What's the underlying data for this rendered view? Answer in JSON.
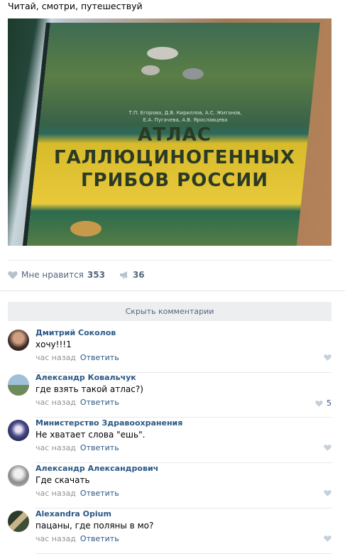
{
  "post": {
    "text": "Читай, смотри, путешествуй",
    "book_authors_line1": "Т.П. Егорова, Д.В. Кириллов, А.С. Жиганов,",
    "book_authors_line2": "Е.А. Пугачева, А.В. Ярославцева",
    "book_title_1": "АТЛАС",
    "book_title_2": "ГАЛЛЮЦИНОГЕННЫХ",
    "book_title_3": "ГРИБОВ РОССИИ",
    "like_label": "Мне нравится",
    "like_count": "353",
    "share_count": "36",
    "hide_comments_label": "Скрыть комментарии"
  },
  "comments": [
    {
      "author": "Дмитрий Соколов",
      "text": "хочу!!!1",
      "time": "час назад",
      "reply": "Ответить",
      "likes": ""
    },
    {
      "author": "Александр Ковальчук",
      "text": "где взять такой атлас?)",
      "time": "час назад",
      "reply": "Ответить",
      "likes": "5"
    },
    {
      "author": "Министерство Здравоохранения",
      "text": "Не хватает слова \"ешь\".",
      "time": "час назад",
      "reply": "Ответить",
      "likes": ""
    },
    {
      "author": "Александр Александрович",
      "text": "Где скачать",
      "time": "час назад",
      "reply": "Ответить",
      "likes": ""
    },
    {
      "author": "Alexandra Opium",
      "text": "пацаны, где поляны в мо?",
      "time": "час назад",
      "reply": "Ответить",
      "likes": ""
    }
  ],
  "icons": {
    "like": "heart-icon",
    "share": "megaphone-icon"
  },
  "colors": {
    "link": "#2a5885",
    "meta": "#939393",
    "action": "#55677d"
  }
}
